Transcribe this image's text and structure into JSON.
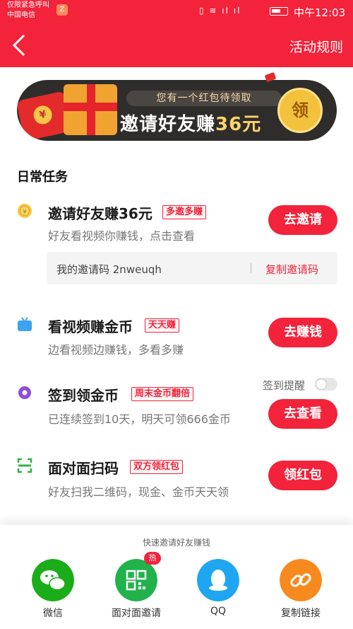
{
  "status_bar": {
    "carrier_line1": "仅限紧急呼叫",
    "carrier_line2": "中国电信",
    "time": "中午12:03"
  },
  "header": {
    "back_icon": "chevron-left-icon",
    "rules_label": "活动规则"
  },
  "banner": {
    "subtitle": "您有一个红包待领取",
    "title": "邀请好友赚",
    "amount": "36元",
    "claim_label": "领"
  },
  "section": {
    "title": "日常任务"
  },
  "tasks": [
    {
      "title": "邀请好友赚36元",
      "tag": "多邀多赚",
      "desc": "好友看视频你赚钱，点击查看",
      "button": "去邀请",
      "icon": "gold-coin-icon"
    },
    {
      "title": "看视频赚金币",
      "tag": "天天赚",
      "desc": "边看视频边赚钱，多看多赚",
      "button": "去赚钱",
      "icon": "tv-icon"
    },
    {
      "title": "签到领金币",
      "tag": "周末金币翻倍",
      "desc": "已连续签到10天，明天可领666金币",
      "button": "去查看",
      "icon": "location-pin-icon"
    },
    {
      "title": "面对面扫码",
      "tag": "双方领红包",
      "desc": "好友扫我二维码，现金、金币天天领",
      "button": "领红包",
      "icon": "scan-icon"
    }
  ],
  "invite_code": {
    "text": "我的邀请码 2nweuqh",
    "copy_label": "复制邀请码"
  },
  "checkin_reminder": {
    "label": "签到提醒"
  },
  "share": {
    "title": "快速邀请好友赚钱",
    "hot_badge": "热",
    "items": [
      {
        "label": "微信",
        "icon": "wechat-icon",
        "color": "#1aad19"
      },
      {
        "label": "面对面邀请",
        "icon": "qr-code-icon",
        "color": "#22b24c"
      },
      {
        "label": "QQ",
        "icon": "qq-icon",
        "color": "#1ea6f2"
      },
      {
        "label": "复制链接",
        "icon": "link-icon",
        "color": "#f78a1e"
      }
    ]
  },
  "colors": {
    "brand_red": "#f2233b",
    "banner_dark": "#2f2d2b",
    "gold": "#f3c23d"
  }
}
